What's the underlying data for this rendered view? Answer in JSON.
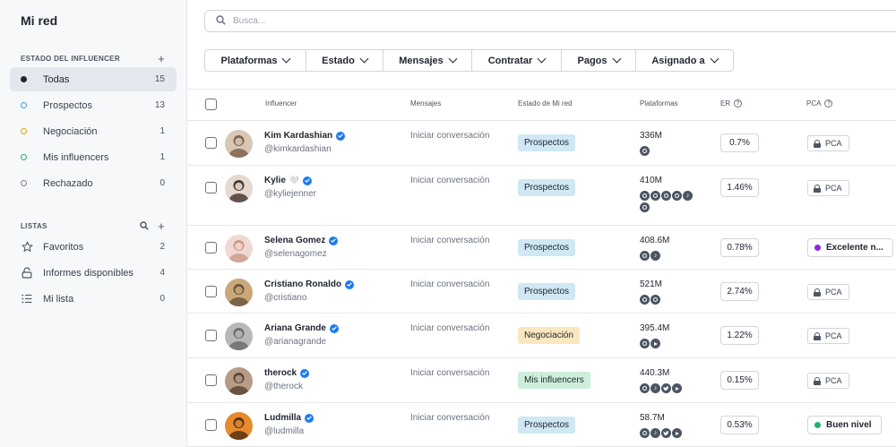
{
  "sidebar": {
    "title": "Mi red",
    "status_section": "ESTADO DEL INFLUENCER",
    "status_add": "+",
    "status_items": [
      {
        "label": "Todas",
        "count": "15",
        "dot": "#1f2430",
        "filled": true
      },
      {
        "label": "Prospectos",
        "count": "13",
        "dot": "#3aa6c9",
        "filled": false
      },
      {
        "label": "Negociación",
        "count": "1",
        "dot": "#e0a800",
        "filled": false
      },
      {
        "label": "Mis influencers",
        "count": "1",
        "dot": "#2fa86a",
        "filled": false
      },
      {
        "label": "Rechazado",
        "count": "0",
        "dot": "#7b8190",
        "filled": false
      }
    ],
    "lists_section": "LISTAS",
    "lists_add": "+",
    "list_items": [
      {
        "label": "Favoritos",
        "count": "2",
        "icon": "star-icon"
      },
      {
        "label": "Informes disponibles",
        "count": "4",
        "icon": "lock-open-icon"
      },
      {
        "label": "Mi lista",
        "count": "0",
        "icon": "list-icon"
      }
    ]
  },
  "search": {
    "placeholder": "Busca..."
  },
  "filters": [
    {
      "label": "Plataformas",
      "w": 113
    },
    {
      "label": "Estado",
      "w": 86
    },
    {
      "label": "Mensajes",
      "w": 99
    },
    {
      "label": "Contratar",
      "w": 100
    },
    {
      "label": "Pagos",
      "w": 83
    },
    {
      "label": "Asignado a",
      "w": 108
    }
  ],
  "columns": {
    "influencer": "Influencer",
    "messages": "Mensajes",
    "status": "Estado de Mi red",
    "platforms": "Plataformas",
    "er": "ER",
    "pca": "PCA"
  },
  "colors": {
    "prospectos": "#cfe8f3",
    "negociacion": "#fbe7bf",
    "mis_influencers": "#cdeedb",
    "verified": "#1d7bf2",
    "excelente": "#8a2be2",
    "buen_nivel": "#1fb36b"
  },
  "rows": [
    {
      "name": "Kim Kardashian",
      "emoji": "",
      "handle": "@kimkardashian",
      "message": "Iniciar conversación",
      "status": "Prospectos",
      "status_kind": "prospectos",
      "followers": "336M",
      "platforms": [
        "instagram"
      ],
      "er": "0.7%",
      "pca_kind": "lock",
      "pca": "PCA",
      "avatar": [
        "#d9c7b6",
        "#6b4f3a"
      ]
    },
    {
      "name": "Kylie",
      "emoji": "🤍",
      "handle": "@kyliejenner",
      "message": "Iniciar conversación",
      "status": "Prospectos",
      "status_kind": "prospectos",
      "followers": "410M",
      "platforms": [
        "instagram",
        "instagram",
        "instagram",
        "instagram",
        "tiktok",
        "instagram"
      ],
      "er": "1.46%",
      "pca_kind": "lock",
      "pca": "PCA",
      "avatar": [
        "#e7d8d0",
        "#2a1a16"
      ]
    },
    {
      "name": "Selena Gomez",
      "emoji": "",
      "handle": "@selenagomez",
      "message": "Iniciar conversación",
      "status": "Prospectos",
      "status_kind": "prospectos",
      "followers": "408.6M",
      "platforms": [
        "instagram",
        "tiktok"
      ],
      "er": "0.78%",
      "pca_kind": "badge",
      "pca": "Excelente n...",
      "badge_color": "#8a2be2",
      "avatar": [
        "#f0d9d2",
        "#c58e7e"
      ]
    },
    {
      "name": "Cristiano Ronaldo",
      "emoji": "",
      "handle": "@cristiano",
      "message": "Iniciar conversación",
      "status": "Prospectos",
      "status_kind": "prospectos",
      "followers": "521M",
      "platforms": [
        "instagram",
        "instagram"
      ],
      "er": "2.74%",
      "pca_kind": "lock",
      "pca": "PCA",
      "avatar": [
        "#c9a77a",
        "#5a4630"
      ]
    },
    {
      "name": "Ariana Grande",
      "emoji": "",
      "handle": "@arianagrande",
      "message": "Iniciar conversación",
      "status": "Negociación",
      "status_kind": "negociacion",
      "followers": "395.4M",
      "platforms": [
        "instagram",
        "youtube"
      ],
      "er": "1.22%",
      "pca_kind": "lock",
      "pca": "PCA",
      "avatar": [
        "#b8b8b8",
        "#5c5c5c"
      ]
    },
    {
      "name": "therock",
      "emoji": "",
      "handle": "@therock",
      "message": "Iniciar conversación",
      "status": "Mis influencers",
      "status_kind": "mis_influencers",
      "followers": "440.3M",
      "platforms": [
        "instagram",
        "tiktok",
        "twitter",
        "youtube"
      ],
      "er": "0.15%",
      "pca_kind": "lock",
      "pca": "PCA",
      "avatar": [
        "#b79b86",
        "#4a3426"
      ]
    },
    {
      "name": "Ludmilla",
      "emoji": "",
      "handle": "@ludmilla",
      "message": "Iniciar conversación",
      "status": "Prospectos",
      "status_kind": "prospectos",
      "followers": "58.7M",
      "platforms": [
        "instagram",
        "tiktok",
        "twitter",
        "youtube"
      ],
      "er": "0.53%",
      "pca_kind": "badge",
      "pca": "Buen nivel",
      "badge_color": "#1fb36b",
      "avatar": [
        "#e68a2e",
        "#3b1f0f"
      ]
    }
  ]
}
